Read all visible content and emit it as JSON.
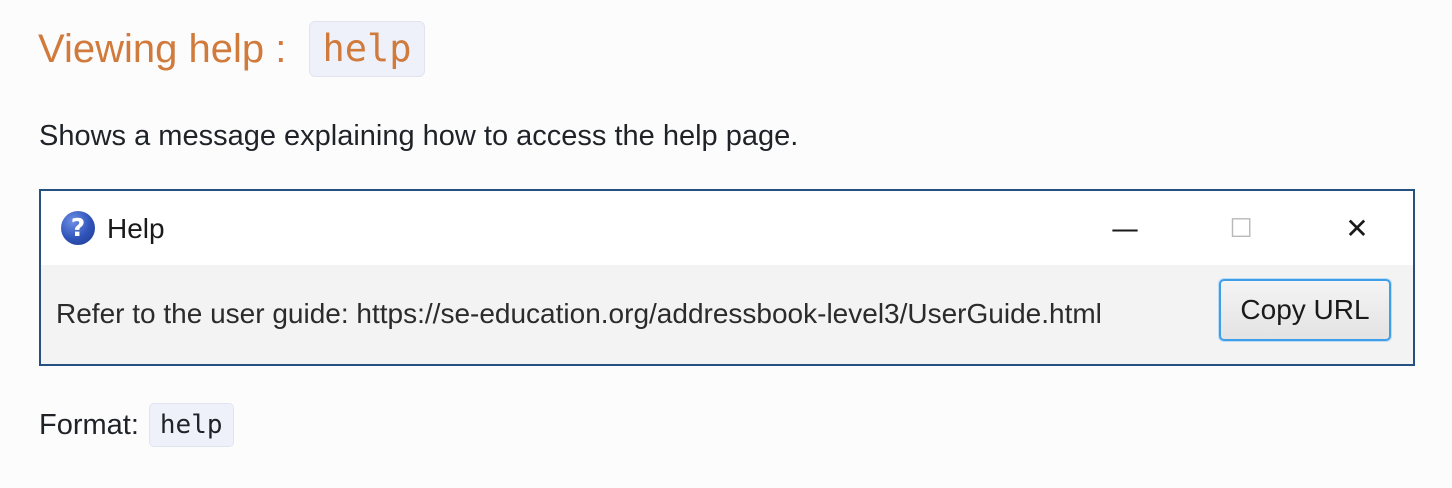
{
  "heading": {
    "prefix": "Viewing help : ",
    "command": "help"
  },
  "description": "Shows a message explaining how to access the help page.",
  "help_window": {
    "title": "Help",
    "icon": "question-mark-icon",
    "controls": {
      "minimize": "—",
      "maximize": "☐",
      "close": "✕"
    },
    "message": "Refer to the user guide: https://se-education.org/addressbook-level3/UserGuide.html",
    "copy_button_label": "Copy URL",
    "colors": {
      "border": "#264f82",
      "button_focus": "#3f9ee8"
    }
  },
  "format": {
    "label": "Format:",
    "command": "help"
  },
  "colors": {
    "heading": "#d07a3c",
    "code_background": "#eff1fa"
  }
}
